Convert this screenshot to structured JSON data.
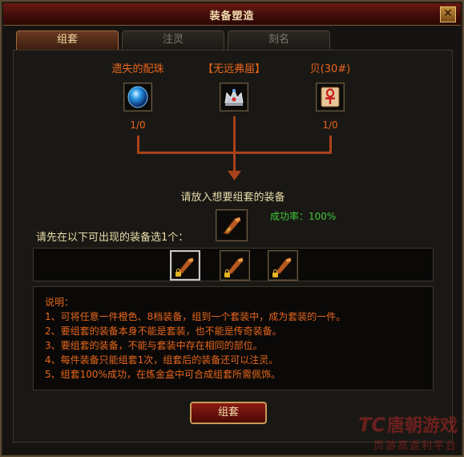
{
  "window": {
    "title": "装备塑造",
    "close_icon": "close-icon"
  },
  "tabs": [
    {
      "label": "组套",
      "active": true
    },
    {
      "label": "注灵",
      "active": false
    },
    {
      "label": "刻名",
      "active": false
    }
  ],
  "materials": [
    {
      "name": "遗失的配珠",
      "count": "1/0",
      "icon": "blue-orb-icon"
    },
    {
      "name": "【无远弗届】",
      "count": "",
      "icon": "silver-crown-icon"
    },
    {
      "name": "贝(30#)",
      "count": "1/0",
      "icon": "ankh-scroll-icon"
    }
  ],
  "target": {
    "prompt": "请放入想要组套的装备",
    "success_label": "成功率：100%",
    "icon": "gauntlet-icon"
  },
  "equipment": {
    "label": "请先在以下可出现的装备选1个：",
    "items": [
      {
        "icon": "gauntlet-icon",
        "locked": true,
        "selected": true
      },
      {
        "icon": "gauntlet-icon",
        "locked": true,
        "selected": false
      },
      {
        "icon": "gauntlet-icon",
        "locked": true,
        "selected": false
      }
    ]
  },
  "description": {
    "lines": [
      "说明：",
      "1、可将任意一件橙色、8档装备，组到一个套装中，成为套装的一件。",
      "2、要组套的装备本身不能是套装，也不能是传奇装备。",
      "3、要组套的装备，不能与套装中存在相同的部位。",
      "4、每件装备只能组套1次，组套后的装备还可以注灵。",
      "5、组套100%成功，在炼金盒中可合成组套所需佩饰。"
    ]
  },
  "actions": {
    "combine_label": "组套"
  },
  "watermark": {
    "main": "唐朝游戏",
    "prefix": "TC",
    "sub": "页游高返利平台"
  },
  "colors": {
    "accent": "#e8661c",
    "success": "#3ec83a",
    "title_bar": "#4a0f0a"
  }
}
